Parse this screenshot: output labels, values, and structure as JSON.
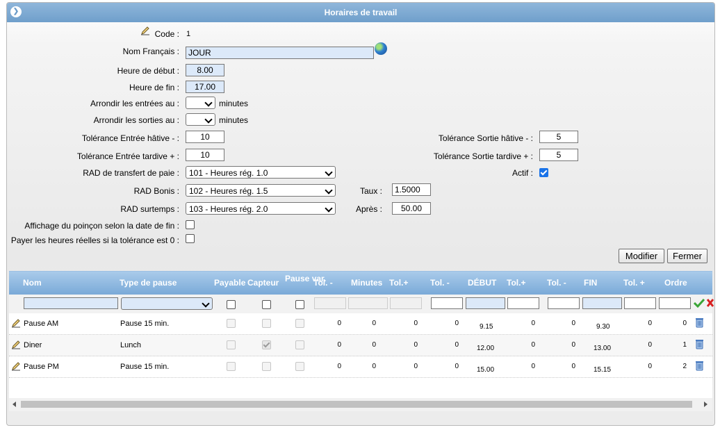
{
  "window": {
    "title": "Horaires de travail"
  },
  "form": {
    "code_label": "Code :",
    "code_value": "1",
    "nom_label": "Nom Français :",
    "nom_value": "JOUR",
    "heure_debut_label": "Heure de début :",
    "heure_debut_value": "8.00",
    "heure_fin_label": "Heure de fin :",
    "heure_fin_value": "17.00",
    "arrondir_entrees_label": "Arrondir les entrées au :",
    "arrondir_sorties_label": "Arrondir les sorties au :",
    "minutes_unit": "minutes",
    "tol_entree_hative_label": "Tolérance Entrée hâtive - :",
    "tol_entree_hative_value": "10",
    "tol_entree_tardive_label": "Tolérance Entrée tardive + :",
    "tol_entree_tardive_value": "10",
    "tol_sortie_hative_label": "Tolérance Sortie hâtive - :",
    "tol_sortie_hative_value": "5",
    "tol_sortie_tardive_label": "Tolérance Sortie tardive + :",
    "tol_sortie_tardive_value": "5",
    "rad_transfert_label": "RAD de transfert de paie :",
    "rad_transfert_value": "101 - Heures rég. 1.0",
    "actif_label": "Actif :",
    "actif_checked": true,
    "rad_bonis_label": "RAD Bonis :",
    "rad_bonis_value": "102 - Heures rég. 1.5",
    "taux_label": "Taux :",
    "taux_value": "1.5000",
    "rad_surtemps_label": "RAD surtemps :",
    "rad_surtemps_value": "103 - Heures rég. 2.0",
    "apres_label": "Après :",
    "apres_value": "50.00",
    "affichage_poincon_label": "Affichage du poinçon selon la date de fin :",
    "payer_heures_label": "Payer les heures réelles si la tolérance est 0 :"
  },
  "buttons": {
    "modifier": "Modifier",
    "fermer": "Fermer"
  },
  "grid": {
    "headers": {
      "nom": "Nom",
      "type_pause": "Type de pause",
      "payable": "Payable",
      "capteur": "Capteur",
      "pause_var": "Pause var.",
      "tol_minus_1": "Tol. -",
      "minutes": "Minutes",
      "tol_plus_1": "Tol.+",
      "tol_minus_2": "Tol. -",
      "debut": "DÉBUT",
      "tol_plus_2": "Tol.+",
      "tol_minus_3": "Tol. -",
      "fin": "FIN",
      "tol_plus_3": "Tol. +",
      "ordre": "Ordre"
    },
    "rows": [
      {
        "nom": "Pause AM",
        "type": "Pause 15 min.",
        "payable": false,
        "capteur": false,
        "pause_var": false,
        "tol1": "0",
        "minutes": "0",
        "tolp1": "0",
        "tol2": "0",
        "debut": "9.15",
        "tolp2": "0",
        "tol3": "0",
        "fin": "9.30",
        "tolp3": "0",
        "ordre": "0"
      },
      {
        "nom": "Diner",
        "type": "Lunch",
        "payable": false,
        "capteur": true,
        "pause_var": false,
        "tol1": "0",
        "minutes": "0",
        "tolp1": "0",
        "tol2": "0",
        "debut": "12.00",
        "tolp2": "0",
        "tol3": "0",
        "fin": "13.00",
        "tolp3": "0",
        "ordre": "1"
      },
      {
        "nom": "Pause PM",
        "type": "Pause 15 min.",
        "payable": false,
        "capteur": false,
        "pause_var": false,
        "tol1": "0",
        "minutes": "0",
        "tolp1": "0",
        "tol2": "0",
        "debut": "15.00",
        "tolp2": "0",
        "tol3": "0",
        "fin": "15.15",
        "tolp3": "0",
        "ordre": "2"
      }
    ]
  },
  "icons": {
    "edit": "pencil-icon",
    "delete": "trash-icon",
    "translate": "globe-icon",
    "accept": "check-icon",
    "cancel": "x-icon"
  },
  "colors": {
    "titlebar": "#7aa8d4",
    "grid_header": "#8fb8e0",
    "input_blue": "#dce9f9",
    "accent": "#1a73e8"
  }
}
